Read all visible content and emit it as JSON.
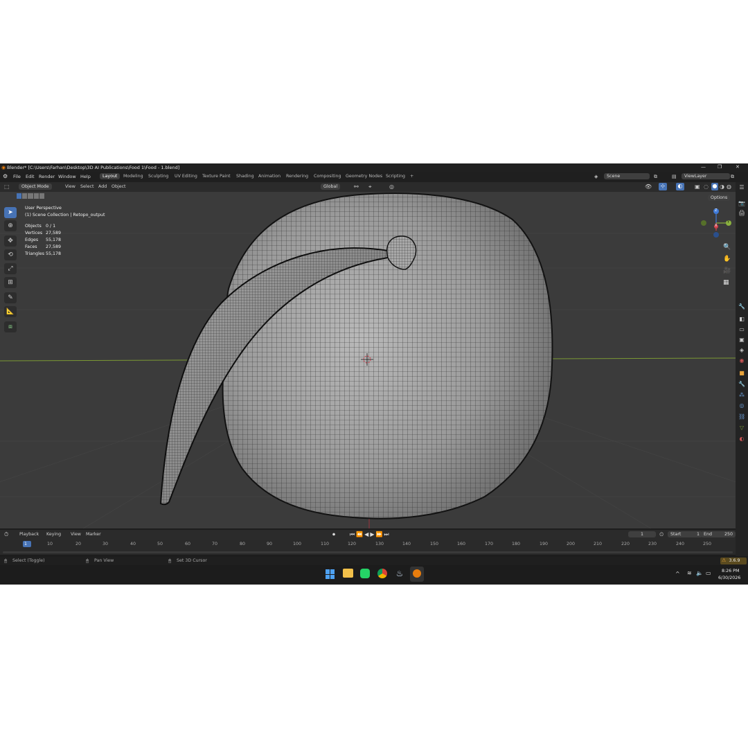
{
  "window": {
    "title": "Blender* [C:\\Users\\Farhan\\Desktop\\3D AI Publications\\Food 1\\Food - 1.blend]",
    "minimize": "—",
    "maximize": "❐",
    "close": "✕"
  },
  "menu": [
    "File",
    "Edit",
    "Render",
    "Window",
    "Help"
  ],
  "workspaces": [
    "Layout",
    "Modeling",
    "Sculpting",
    "UV Editing",
    "Texture Paint",
    "Shading",
    "Animation",
    "Rendering",
    "Compositing",
    "Geometry Nodes",
    "Scripting"
  ],
  "add_workspace": "+",
  "scene": {
    "name": "Scene",
    "view_layer": "ViewLayer"
  },
  "header": {
    "mode": "Object Mode",
    "view": "View",
    "select": "Select",
    "add": "Add",
    "object": "Object",
    "transform": "Global",
    "options": "Options"
  },
  "viewport": {
    "perspective": "User Perspective",
    "collection": "(1) Scene Collection | Retopo_output",
    "stats": [
      {
        "label": "Objects",
        "value": "0 / 1"
      },
      {
        "label": "Vertices",
        "value": "27,589"
      },
      {
        "label": "Edges",
        "value": "55,178"
      },
      {
        "label": "Faces",
        "value": "27,589"
      },
      {
        "label": "Triangles",
        "value": "55,178"
      }
    ],
    "gizmo": {
      "x": "X",
      "y": "Y",
      "z": "Z"
    }
  },
  "timeline": {
    "playback": "Playback",
    "keying": "Keying",
    "view": "View",
    "marker": "Marker",
    "current_frame": "1",
    "start_label": "Start",
    "start": "1",
    "end_label": "End",
    "end": "250",
    "ticks": [
      "1",
      "10",
      "20",
      "30",
      "40",
      "50",
      "60",
      "70",
      "80",
      "90",
      "100",
      "110",
      "120",
      "130",
      "140",
      "150",
      "160",
      "170",
      "180",
      "190",
      "200",
      "210",
      "220",
      "230",
      "240",
      "250"
    ]
  },
  "statusbar": {
    "select": "Select (Toggle)",
    "pan": "Pan View",
    "cursor": "Set 3D Cursor",
    "version": "3.6.9"
  },
  "taskbar": {
    "time": "8:26 PM",
    "date": "6/30/2026"
  },
  "colors": {
    "accent": "#4773b5",
    "viewport_bg": "#3b3b3b",
    "x_axis": "#cf3f4a",
    "y_axis": "#8ab13f",
    "z_axis": "#3f7ad8",
    "warning": "#e8a33a"
  }
}
